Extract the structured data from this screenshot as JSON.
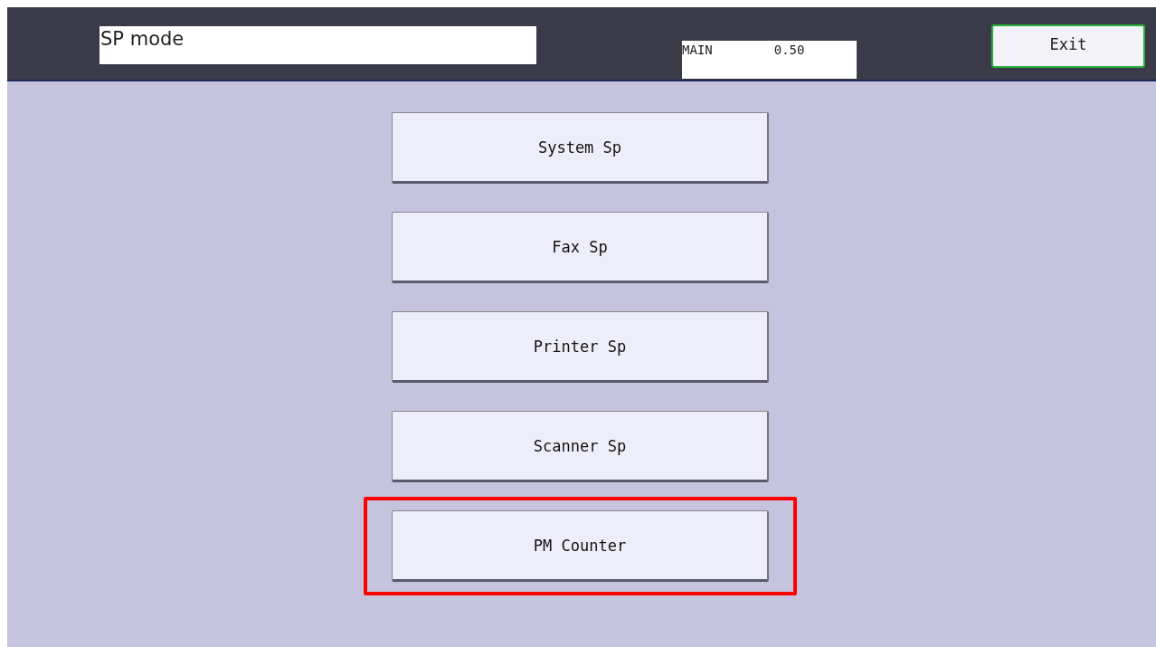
{
  "header": {
    "title": "SP mode",
    "status_label": "MAIN",
    "status_value": "0.50",
    "exit_button": "Exit"
  },
  "menu_items": [
    {
      "label": "System Sp",
      "highlighted": false
    },
    {
      "label": "Fax Sp",
      "highlighted": false
    },
    {
      "label": "Printer Sp",
      "highlighted": false
    },
    {
      "label": "Scanner Sp",
      "highlighted": false
    },
    {
      "label": "PM Counter",
      "highlighted": true
    }
  ]
}
